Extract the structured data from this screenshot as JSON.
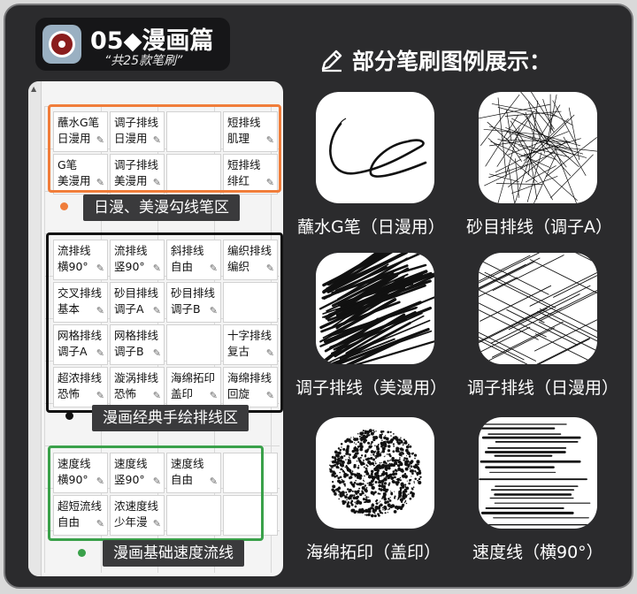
{
  "header": {
    "title": "05◆漫画篇",
    "subtitle": "“共25款笔刷”"
  },
  "showcase": {
    "heading": "部分笔刷图例展示：",
    "samples": [
      {
        "label": "蘸水G笔（日漫用）",
        "icon": "ink-curve-stroke"
      },
      {
        "label": "砂目排线（调子A）",
        "icon": "cross-hatch-texture"
      },
      {
        "label": "调子排线（美漫用）",
        "icon": "dense-hatch-strokes"
      },
      {
        "label": "调子排线（日漫用）",
        "icon": "fine-hatch-strokes"
      },
      {
        "label": "海绵拓印（盖印）",
        "icon": "sponge-stamp-texture"
      },
      {
        "label": "速度线（横90°）",
        "icon": "speed-lines"
      }
    ]
  },
  "sections": [
    {
      "label": "日漫、美漫勾线笔区",
      "color": "#f07d3a",
      "cells": [
        {
          "line1": "蘸水G笔",
          "line2": "日漫用"
        },
        {
          "line1": "调子排线",
          "line2": "日漫用"
        },
        {
          "line1": "",
          "line2": ""
        },
        {
          "line1": "短排线",
          "line2": "肌理"
        },
        {
          "line1": "G笔",
          "line2": "美漫用"
        },
        {
          "line1": "调子排线",
          "line2": "美漫用"
        },
        {
          "line1": "",
          "line2": ""
        },
        {
          "line1": "短排线",
          "line2": "绯红"
        }
      ]
    },
    {
      "label": "漫画经典手绘排线区",
      "color": "#111111",
      "cells": [
        {
          "line1": "流排线",
          "line2": "横90°"
        },
        {
          "line1": "流排线",
          "line2": "竖90°"
        },
        {
          "line1": "斜排线",
          "line2": "自由"
        },
        {
          "line1": "编织排线",
          "line2": "编织"
        },
        {
          "line1": "交叉排线",
          "line2": "基本"
        },
        {
          "line1": "砂目排线",
          "line2": "调子A"
        },
        {
          "line1": "砂目排线",
          "line2": "调子B"
        },
        {
          "line1": "",
          "line2": ""
        },
        {
          "line1": "网格排线",
          "line2": "调子A"
        },
        {
          "line1": "网格排线",
          "line2": "调子B"
        },
        {
          "line1": "",
          "line2": ""
        },
        {
          "line1": "十字排线",
          "line2": "复古"
        },
        {
          "line1": "超浓排线",
          "line2": "恐怖"
        },
        {
          "line1": "漩涡排线",
          "line2": "恐怖"
        },
        {
          "line1": "海绵拓印",
          "line2": "盖印"
        },
        {
          "line1": "海绵排线",
          "line2": "回旋"
        }
      ]
    },
    {
      "label": "漫画基础速度流线",
      "color": "#3aa14a",
      "cells": [
        {
          "line1": "速度线",
          "line2": "横90°"
        },
        {
          "line1": "速度线",
          "line2": "竖90°"
        },
        {
          "line1": "速度线",
          "line2": "自由"
        },
        {
          "line1": "",
          "line2": ""
        },
        {
          "line1": "超短流线",
          "line2": "自由"
        },
        {
          "line1": "浓速度线",
          "line2": "少年漫"
        },
        {
          "line1": "",
          "line2": ""
        },
        {
          "line1": "",
          "line2": ""
        }
      ]
    }
  ]
}
